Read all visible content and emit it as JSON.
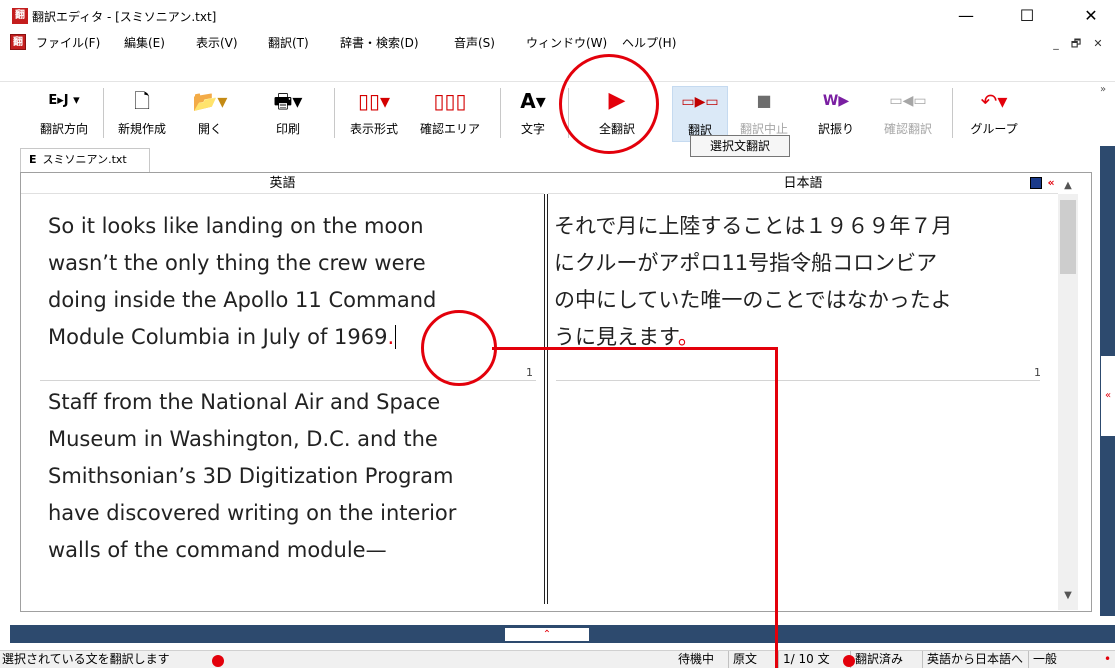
{
  "window": {
    "title": "翻訳エディタ - [スミソニアン.txt]",
    "app_icon": "翻",
    "minimize": "—",
    "maximize": "☐",
    "close": "✕"
  },
  "menubar": {
    "icon": "翻",
    "items": [
      "ファイル(F)",
      "編集(E)",
      "表示(V)",
      "翻訳(T)",
      "辞書・検索(D)",
      "音声(S)",
      "ウィンドウ(W)",
      "ヘルプ(H)"
    ],
    "mdi": [
      "_",
      "🗗",
      "✕"
    ]
  },
  "toolbar": {
    "direction": {
      "icon": "E▸J ▾",
      "label": "翻訳方向"
    },
    "new": {
      "icon": "🗋",
      "label": "新規作成"
    },
    "open": {
      "icon": "📂▾",
      "label": "開く"
    },
    "print": {
      "icon": "🖶▾",
      "label": "印刷"
    },
    "display": {
      "icon": "▯▯▾",
      "label": "表示形式"
    },
    "confirm_area": {
      "icon": "▯▯▯",
      "label": "確認エリア"
    },
    "font": {
      "icon": "A▾",
      "label": "文字"
    },
    "translate_all": {
      "icon": "▶",
      "label": "全翻訳"
    },
    "translate_sel": {
      "icon": "▭▶▭",
      "label": "翻訳"
    },
    "stop": {
      "icon": "■",
      "label": "翻訳中止"
    },
    "furigana": {
      "icon": "W▶",
      "label": "訳振り"
    },
    "confirm_translate": {
      "icon": "▭◀▭",
      "label": "確認翻訳"
    },
    "group": {
      "icon": "↶▾",
      "label": "グループ"
    },
    "overflow": "»"
  },
  "tooltip": "選択文翻訳",
  "doc_tab": {
    "prefix": "E",
    "name": "スミソニアン.txt"
  },
  "editor": {
    "left_header": "英語",
    "right_header": "日本語",
    "segments": [
      {
        "source_lines": [
          "So it looks like landing on the moon",
          "wasn’t the only thing the crew were",
          "doing inside the Apollo 11 Command",
          "Module Columbia in July of 1969"
        ],
        "source_period": ".",
        "target_lines": [
          "それで月に上陸することは１９６９年７月",
          "にクルーがアポロ11号指令船コロンビア",
          "の中にしていた唯一のことではなかったよ",
          "うに見えます"
        ],
        "target_period": "。",
        "num": "1"
      },
      {
        "source_lines": [
          "Staff from the National Air and Space",
          "Museum in Washington, D.C. and the",
          "Smithsonian’s 3D Digitization Program",
          "have discovered writing on the interior",
          "walls of the command module—"
        ],
        "target_lines": []
      }
    ],
    "header_badge": "«"
  },
  "status": {
    "message": "選択されている文を翻訳します",
    "state": "待機中",
    "source": "原文",
    "count": "1/ 10 文",
    "translated": "翻訳済み",
    "direction": "英語から日本語へ",
    "field": "一般"
  },
  "colors": {
    "accent_red": "#e3000b",
    "strip_blue": "#2d4a6e",
    "highlight": "#dbe9f7"
  }
}
